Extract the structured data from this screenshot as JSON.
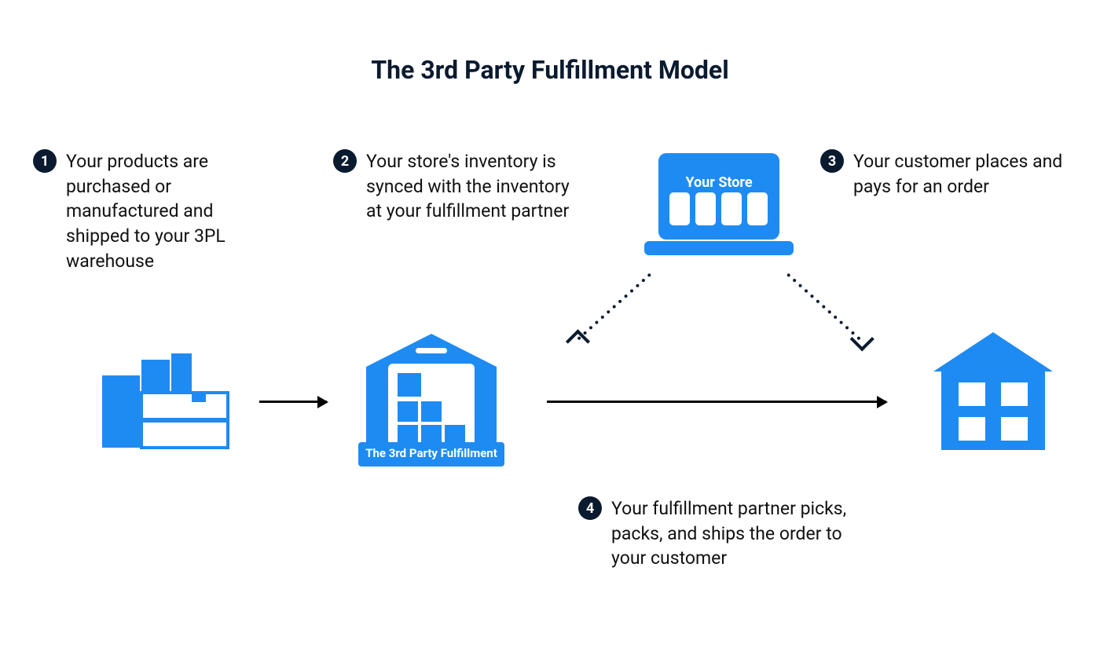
{
  "title": "The 3rd Party Fulfillment Model",
  "steps": [
    {
      "num": "1",
      "text": "Your products are purchased or manufactured and shipped to your 3PL warehouse"
    },
    {
      "num": "2",
      "text": "Your store's inventory is synced with the inventory at your fulfillment partner"
    },
    {
      "num": "3",
      "text": "Your customer places and pays for an order"
    },
    {
      "num": "4",
      "text": "Your fulfillment partner picks, packs, and ships the order to your customer"
    }
  ],
  "labels": {
    "store": "Your Store",
    "warehouse": "The 3rd Party Fulfillment"
  },
  "colors": {
    "brand": "#1e8bf2",
    "dark": "#0a1a2f"
  }
}
